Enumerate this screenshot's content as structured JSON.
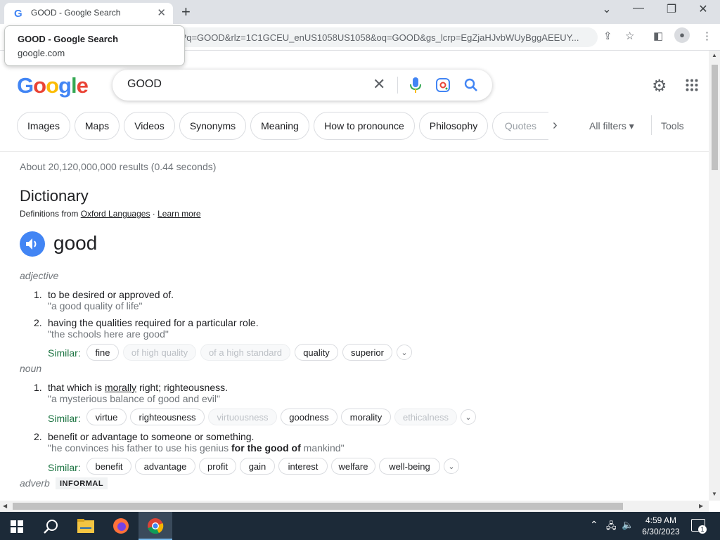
{
  "browser": {
    "tab_title": "GOOD - Google Search",
    "tab_favicon": "G",
    "url": "?q=GOOD&rlz=1C1GCEU_enUS1058US1058&oq=GOOD&gs_lcrp=EgZjaHJvbWUyBggAEEUY...",
    "tooltip_title": "GOOD - Google Search",
    "tooltip_domain": "google.com"
  },
  "google": {
    "logo_letters": [
      "G",
      "o",
      "o",
      "g",
      "l",
      "e"
    ],
    "query": "GOOD",
    "chips": [
      "Images",
      "Maps",
      "Videos",
      "Synonyms",
      "Meaning",
      "How to pronounce",
      "Philosophy",
      "Quotes"
    ],
    "all_filters": "All filters",
    "tools": "Tools",
    "stats": "About 20,120,000,000 results (0.44 seconds)"
  },
  "dictionary": {
    "title": "Dictionary",
    "source_prefix": "Definitions from ",
    "source_name": "Oxford Languages",
    "source_sep": " · ",
    "learn_more": "Learn more",
    "word": "good",
    "adjective_label": "adjective",
    "adj_defs": [
      {
        "num": "1.",
        "def": "to be desired or approved of.",
        "ex": "\"a good quality of life\""
      },
      {
        "num": "2.",
        "def": "having the qualities required for a particular role.",
        "ex": "\"the schools here are good\""
      }
    ],
    "adj_similar": [
      "fine",
      "of high quality",
      "of a high standard",
      "quality",
      "superior"
    ],
    "noun_label": "noun",
    "noun_def1_num": "1.",
    "noun_def1_pre": "that which is ",
    "noun_def1_link": "morally",
    "noun_def1_post": " right; righteousness.",
    "noun_def1_ex": "\"a mysterious balance of good and evil\"",
    "noun_similar1": [
      "virtue",
      "righteousness",
      "virtuousness",
      "goodness",
      "morality",
      "ethicalness"
    ],
    "noun_def2_num": "2.",
    "noun_def2": "benefit or advantage to someone or something.",
    "noun_def2_ex_pre": "\"he convinces his father to use his genius ",
    "noun_def2_ex_bold": "for the good of",
    "noun_def2_ex_post": " mankind\"",
    "noun_similar2": [
      "benefit",
      "advantage",
      "profit",
      "gain",
      "interest",
      "welfare",
      "well-being"
    ],
    "similar_label": "Similar:",
    "adverb_label": "adverb",
    "informal_label": "INFORMAL"
  },
  "taskbar": {
    "time": "4:59 AM",
    "date": "6/30/2023",
    "notifications": "1"
  }
}
